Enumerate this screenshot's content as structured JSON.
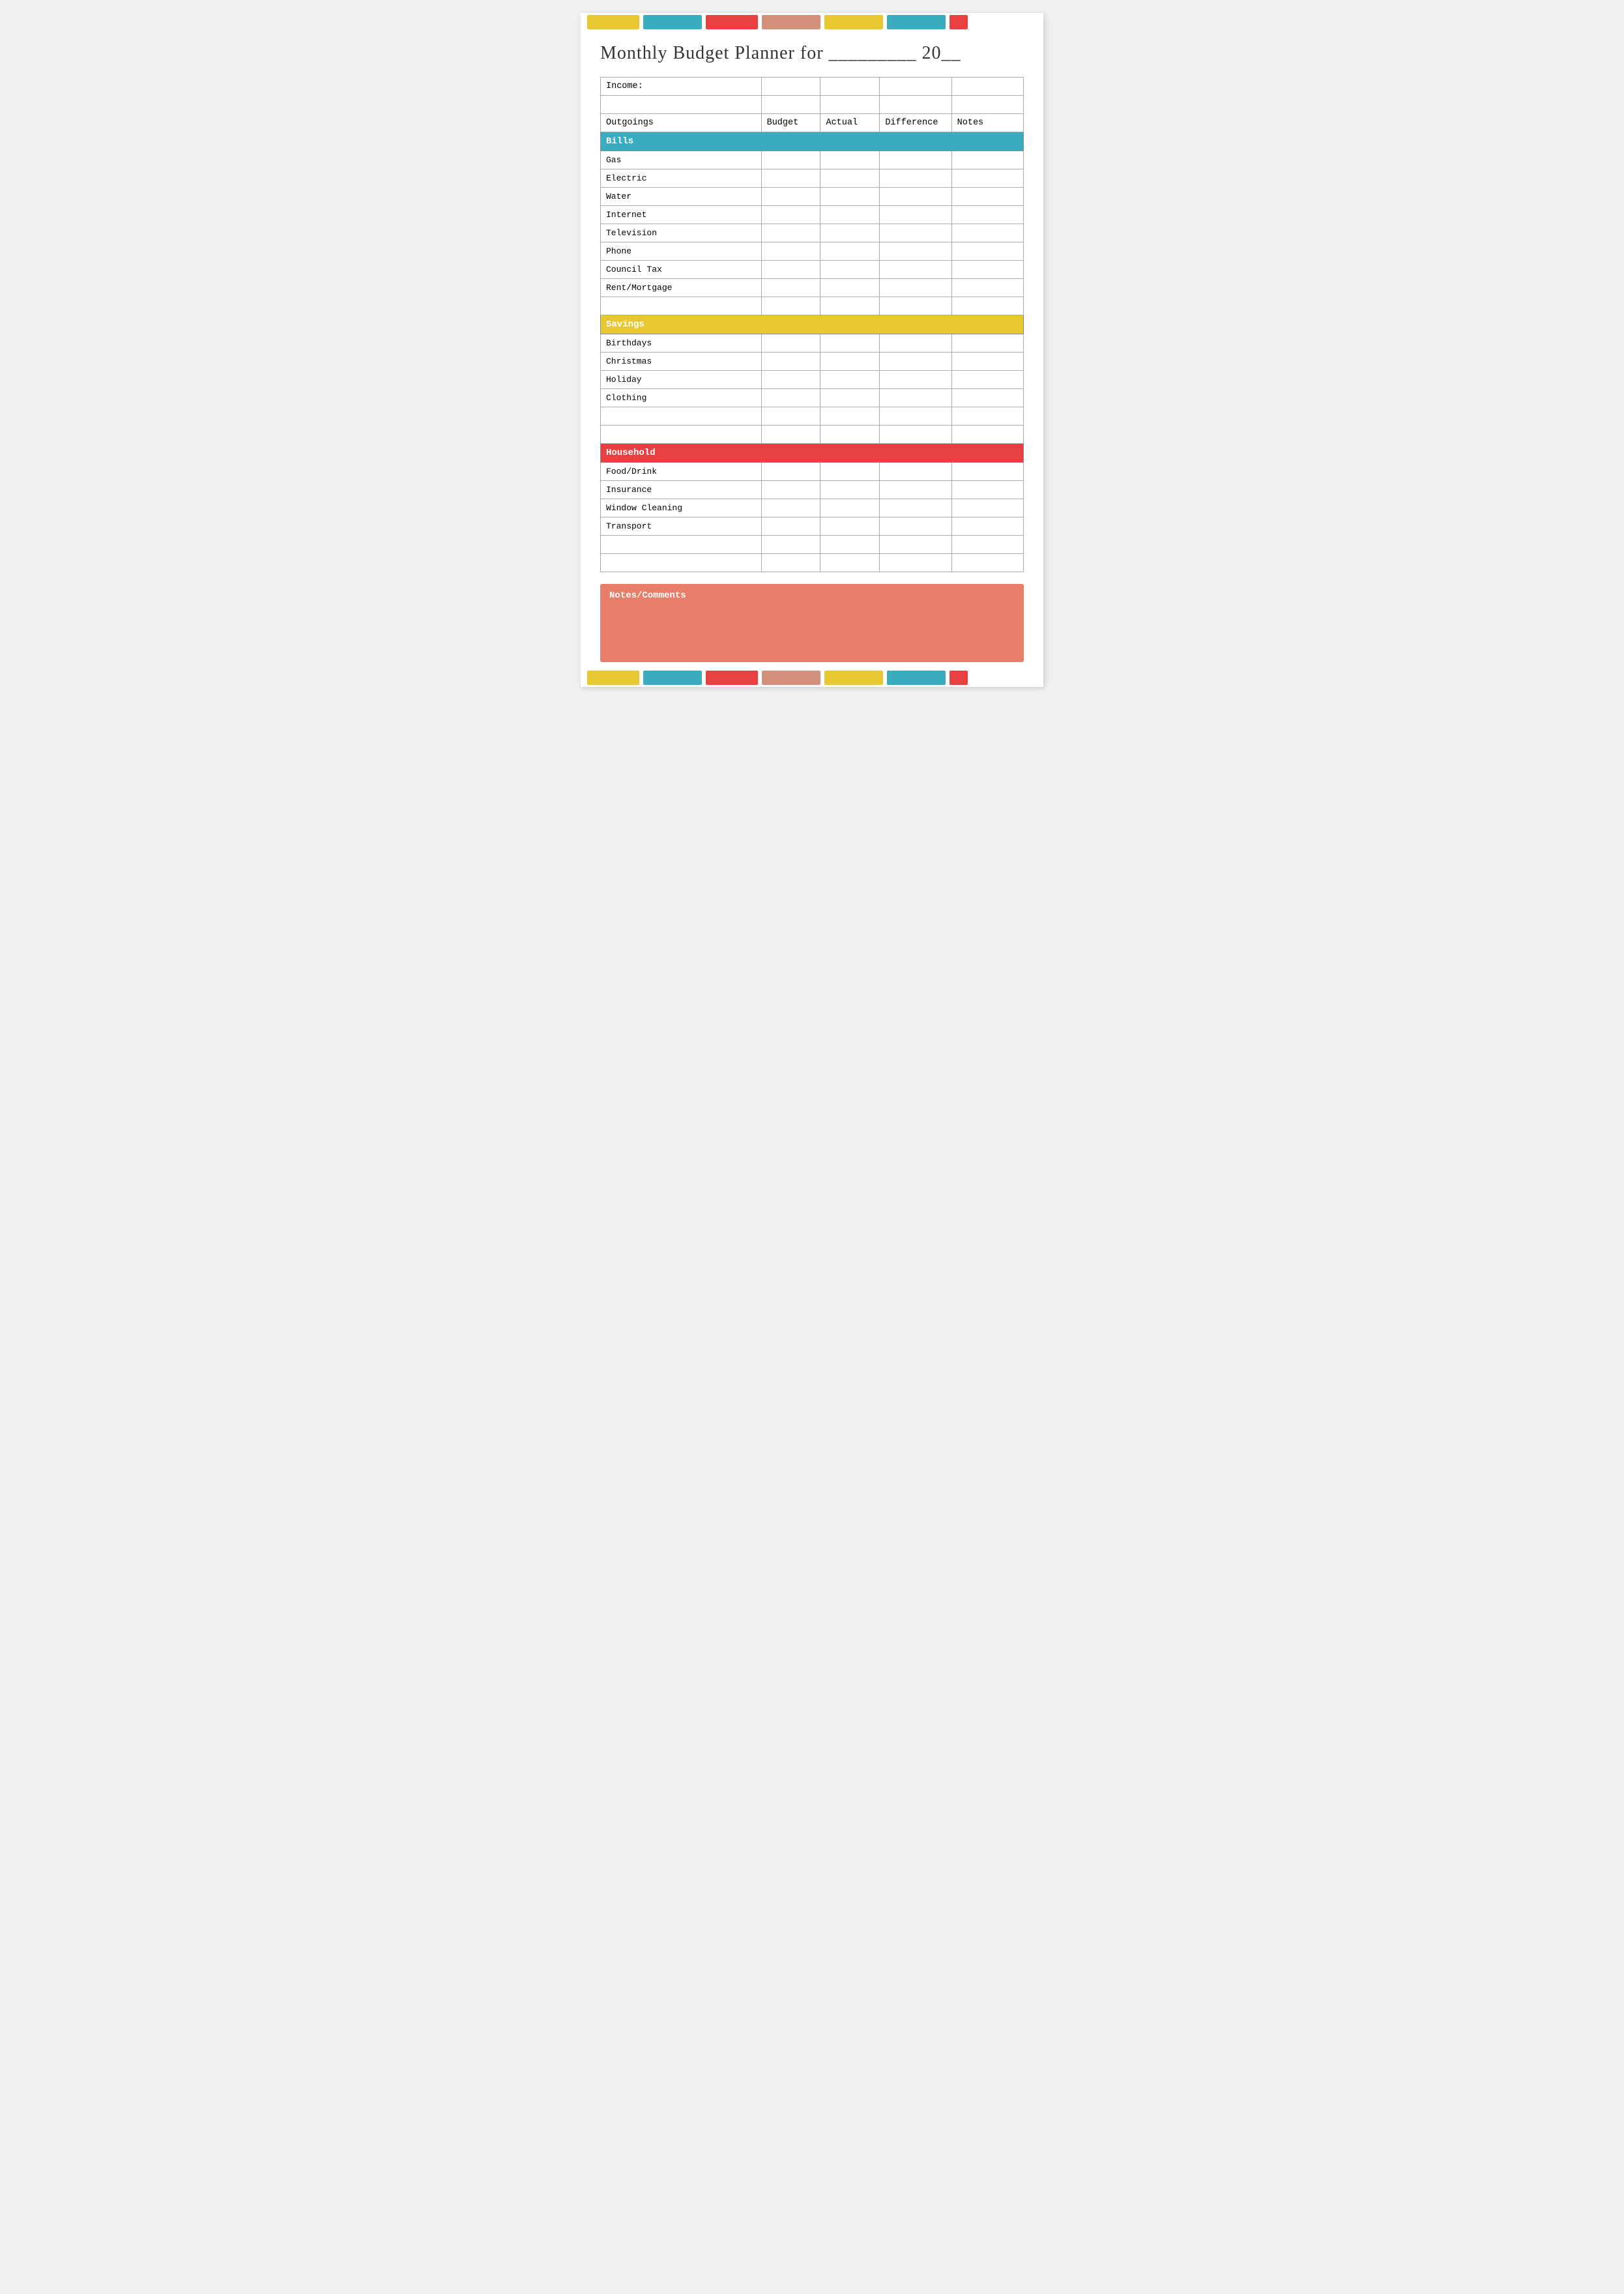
{
  "deco_bars": {
    "top": [
      {
        "color": "#e8c832",
        "width": 80
      },
      {
        "color": "#3aacbf",
        "width": 90
      },
      {
        "color": "#e84040",
        "width": 80
      },
      {
        "color": "#d4907a",
        "width": 90
      },
      {
        "color": "#e8c832",
        "width": 90
      },
      {
        "color": "#3aacbf",
        "width": 90
      },
      {
        "color": "#e84040",
        "width": 28
      }
    ],
    "bottom": [
      {
        "color": "#e8c832",
        "width": 80
      },
      {
        "color": "#3aacbf",
        "width": 90
      },
      {
        "color": "#e84040",
        "width": 80
      },
      {
        "color": "#d4907a",
        "width": 90
      },
      {
        "color": "#e8c832",
        "width": 90
      },
      {
        "color": "#3aacbf",
        "width": 90
      },
      {
        "color": "#e84040",
        "width": 28
      }
    ]
  },
  "title": {
    "text": "Monthly Budget Planner for _________ 20__"
  },
  "table": {
    "income_label": "Income:",
    "columns": {
      "label": "Outgoings",
      "budget": "Budget",
      "actual": "Actual",
      "difference": "Difference",
      "notes": "Notes"
    },
    "sections": [
      {
        "name": "Bills",
        "color": "bills-header",
        "items": [
          "Gas",
          "Electric",
          "Water",
          "Internet",
          "Television",
          "Phone",
          "Council Tax",
          "Rent/Mortgage"
        ]
      },
      {
        "name": "Savings",
        "color": "savings-header",
        "items": [
          "Birthdays",
          "Christmas",
          "Holiday",
          "Clothing"
        ]
      },
      {
        "name": "Household",
        "color": "household-header",
        "items": [
          "Food/Drink",
          "Insurance",
          "Window Cleaning",
          "Transport"
        ]
      }
    ]
  },
  "notes": {
    "title": "Notes/Comments"
  }
}
